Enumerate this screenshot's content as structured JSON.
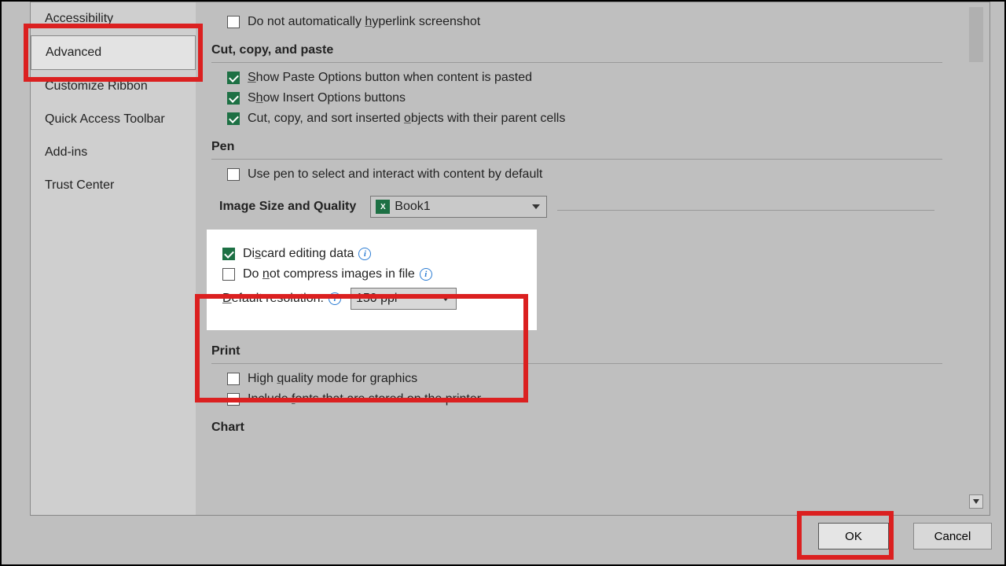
{
  "sidebar": {
    "items": [
      {
        "label": "Accessibility"
      },
      {
        "label": "Advanced"
      },
      {
        "label": "Customize Ribbon"
      },
      {
        "label": "Quick Access Toolbar"
      },
      {
        "label": "Add-ins"
      },
      {
        "label": "Trust Center"
      }
    ]
  },
  "options": {
    "hyperlink_screenshot": "Do not automatically hyperlink screenshot",
    "section_ccp": "Cut, copy, and paste",
    "show_paste": "Show Paste Options button when content is pasted",
    "show_insert": "Show Insert Options buttons",
    "cut_copy_sort": "Cut, copy, and sort inserted objects with their parent cells",
    "section_pen": "Pen",
    "use_pen": "Use pen to select and interact with content by default",
    "section_img": "Image Size and Quality",
    "workbook": "Book1",
    "discard": "Discard editing data",
    "nocompress": "Do not compress images in file",
    "default_res_label": "Default resolution:",
    "default_res_value": "150 ppi",
    "section_print": "Print",
    "hq_graphics": "High quality mode for graphics",
    "include_fonts": "Include fonts that are stored on the printer",
    "section_chart": "Chart"
  },
  "buttons": {
    "ok": "OK",
    "cancel": "Cancel"
  }
}
